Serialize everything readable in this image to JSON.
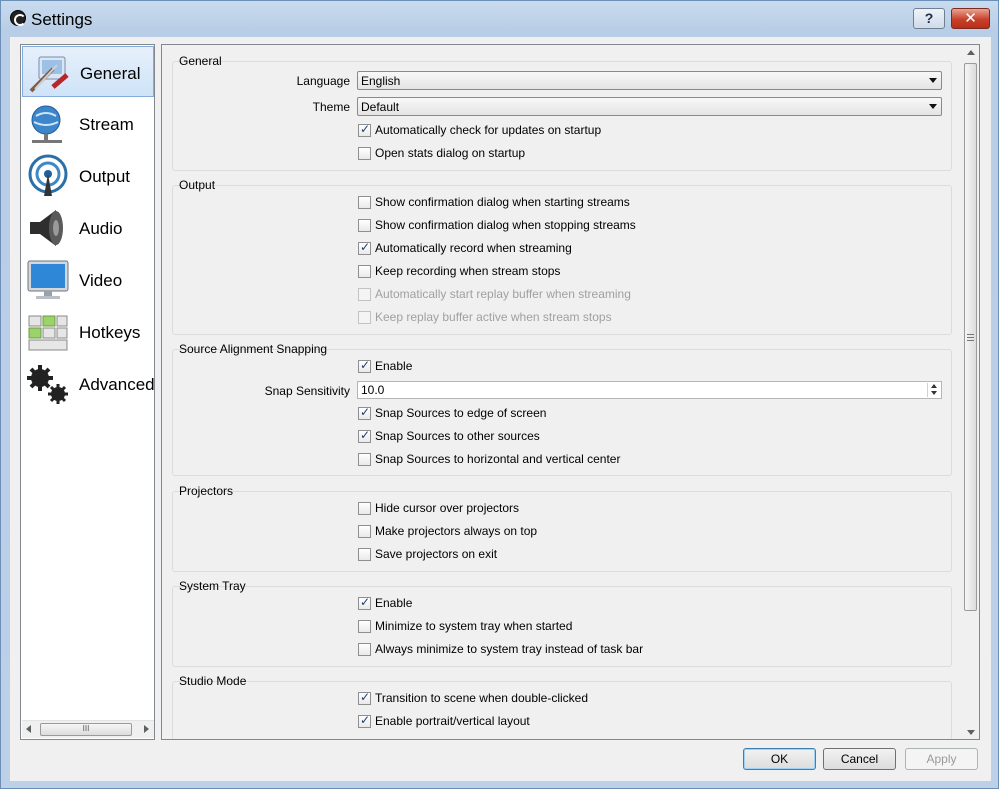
{
  "window": {
    "title": "Settings",
    "help_label": "?",
    "close_label": "✕"
  },
  "sidebar": {
    "items": [
      {
        "label": "General",
        "icon": "general-icon",
        "selected": true
      },
      {
        "label": "Stream",
        "icon": "stream-icon"
      },
      {
        "label": "Output",
        "icon": "output-icon"
      },
      {
        "label": "Audio",
        "icon": "audio-icon"
      },
      {
        "label": "Video",
        "icon": "video-icon"
      },
      {
        "label": "Hotkeys",
        "icon": "hotkeys-icon"
      },
      {
        "label": "Advanced",
        "icon": "advanced-icon"
      }
    ],
    "scroll_grip": "III"
  },
  "general": {
    "title": "General",
    "language_label": "Language",
    "language_value": "English",
    "theme_label": "Theme",
    "theme_value": "Default",
    "check_updates": "Automatically check for updates on startup",
    "open_stats": "Open stats dialog on startup"
  },
  "output": {
    "title": "Output",
    "confirm_start": "Show confirmation dialog when starting streams",
    "confirm_stop": "Show confirmation dialog when stopping streams",
    "auto_record": "Automatically record when streaming",
    "keep_recording": "Keep recording when stream stops",
    "auto_replay": "Automatically start replay buffer when streaming",
    "keep_replay": "Keep replay buffer active when stream stops"
  },
  "snapping": {
    "title": "Source Alignment Snapping",
    "enable": "Enable",
    "sensitivity_label": "Snap Sensitivity",
    "sensitivity_value": "10.0",
    "edge": "Snap Sources to edge of screen",
    "other": "Snap Sources to other sources",
    "center": "Snap Sources to horizontal and vertical center"
  },
  "projectors": {
    "title": "Projectors",
    "hide_cursor": "Hide cursor over projectors",
    "always_on_top": "Make projectors always on top",
    "save_on_exit": "Save projectors on exit"
  },
  "tray": {
    "title": "System Tray",
    "enable": "Enable",
    "minimize_start": "Minimize to system tray when started",
    "always_minimize": "Always minimize to system tray instead of task bar"
  },
  "studio": {
    "title": "Studio Mode",
    "transition_dblclick": "Transition to scene when double-clicked",
    "portrait_layout": "Enable portrait/vertical layout"
  },
  "buttons": {
    "ok": "OK",
    "cancel": "Cancel",
    "apply": "Apply"
  },
  "colors": {
    "selection": "#cfe3f8",
    "close": "#c8412b",
    "check": "#1d3f6b"
  }
}
